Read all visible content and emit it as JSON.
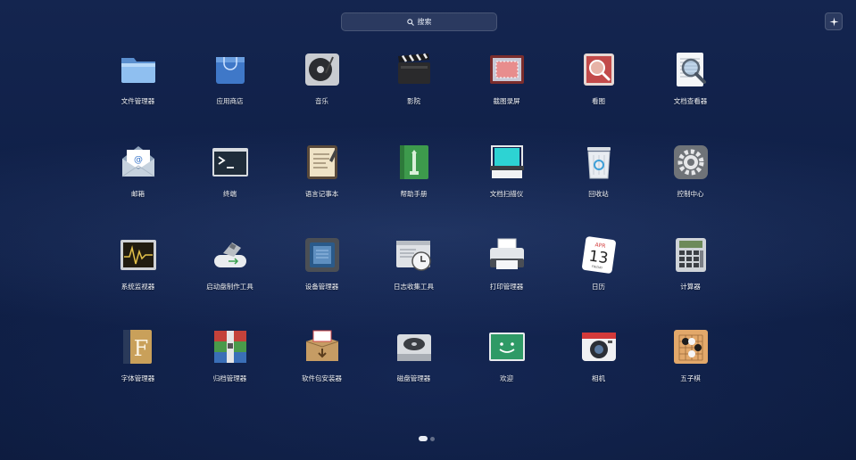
{
  "search": {
    "label": "搜索"
  },
  "apps": [
    {
      "label": "文件管理器",
      "icon": "folder-icon"
    },
    {
      "label": "应用商店",
      "icon": "store-bag-icon"
    },
    {
      "label": "音乐",
      "icon": "music-player-icon"
    },
    {
      "label": "影院",
      "icon": "clapperboard-icon"
    },
    {
      "label": "截图录屏",
      "icon": "screenshot-icon"
    },
    {
      "label": "看图",
      "icon": "image-viewer-icon"
    },
    {
      "label": "文档查看器",
      "icon": "document-viewer-icon"
    },
    {
      "label": "邮箱",
      "icon": "mail-icon"
    },
    {
      "label": "终端",
      "icon": "terminal-icon"
    },
    {
      "label": "语言记事本",
      "icon": "notebook-icon"
    },
    {
      "label": "帮助手册",
      "icon": "manual-icon"
    },
    {
      "label": "文档扫描仪",
      "icon": "scanner-icon"
    },
    {
      "label": "回收站",
      "icon": "trash-icon"
    },
    {
      "label": "控制中心",
      "icon": "gear-icon"
    },
    {
      "label": "系统监视器",
      "icon": "system-monitor-icon"
    },
    {
      "label": "启动盘制作工具",
      "icon": "usb-drive-icon"
    },
    {
      "label": "设备管理器",
      "icon": "device-manager-icon"
    },
    {
      "label": "日志收集工具",
      "icon": "log-clock-icon"
    },
    {
      "label": "打印管理器",
      "icon": "printer-icon"
    },
    {
      "label": "日历",
      "icon": "calendar-icon",
      "month": "APR",
      "day": "13",
      "weekday": "FRIDAY"
    },
    {
      "label": "计算器",
      "icon": "calculator-icon"
    },
    {
      "label": "字体管理器",
      "icon": "font-book-icon",
      "glyph": "F"
    },
    {
      "label": "归档管理器",
      "icon": "archive-icon"
    },
    {
      "label": "软件包安装器",
      "icon": "package-installer-icon"
    },
    {
      "label": "磁盘管理器",
      "icon": "disk-icon"
    },
    {
      "label": "欢迎",
      "icon": "welcome-smile-icon"
    },
    {
      "label": "相机",
      "icon": "camera-icon"
    },
    {
      "label": "五子棋",
      "icon": "gomoku-icon"
    }
  ],
  "pager": {
    "pages": 2,
    "current": 1
  }
}
